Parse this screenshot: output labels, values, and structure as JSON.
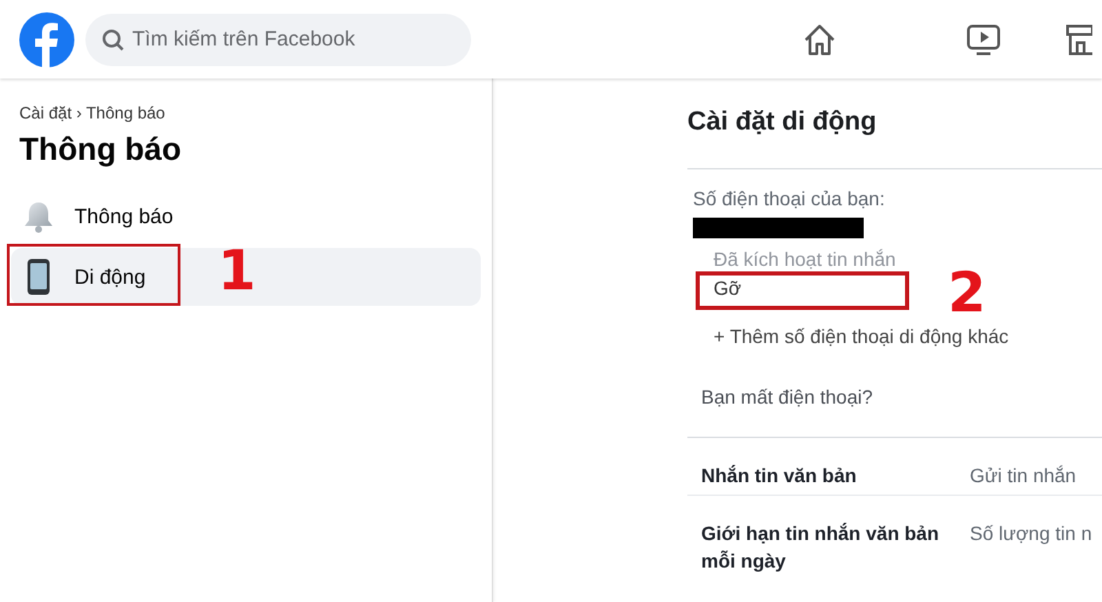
{
  "header": {
    "search": {
      "placeholder": "Tìm kiếm trên Facebook"
    },
    "nav_icons": [
      {
        "kind": "home"
      },
      {
        "kind": "video"
      },
      {
        "kind": "store"
      }
    ]
  },
  "sidebar": {
    "breadcrumb": "Cài đặt › Thông báo",
    "title": "Thông báo",
    "items": [
      {
        "label": "Thông báo",
        "kind": "bell",
        "selected": false
      },
      {
        "label": "Di động",
        "kind": "phone",
        "selected": true,
        "annotation": "1"
      }
    ]
  },
  "content": {
    "title": "Cài đặt di động",
    "phone": {
      "label": "Số điện thoại của bạn:",
      "status": "Đã kích hoạt tin nhắn",
      "remove": "Gỡ",
      "remove_annotation": "2",
      "add": "+ Thêm số điện thoại di động khác"
    },
    "lost_phone": "Bạn mất điện thoại?",
    "rows": [
      {
        "label": "Nhắn tin văn bản",
        "value": "Gửi tin nhắn"
      },
      {
        "label": "Giới hạn tin nhắn văn bản mỗi ngày",
        "value": "Số lượng tin n"
      }
    ]
  }
}
